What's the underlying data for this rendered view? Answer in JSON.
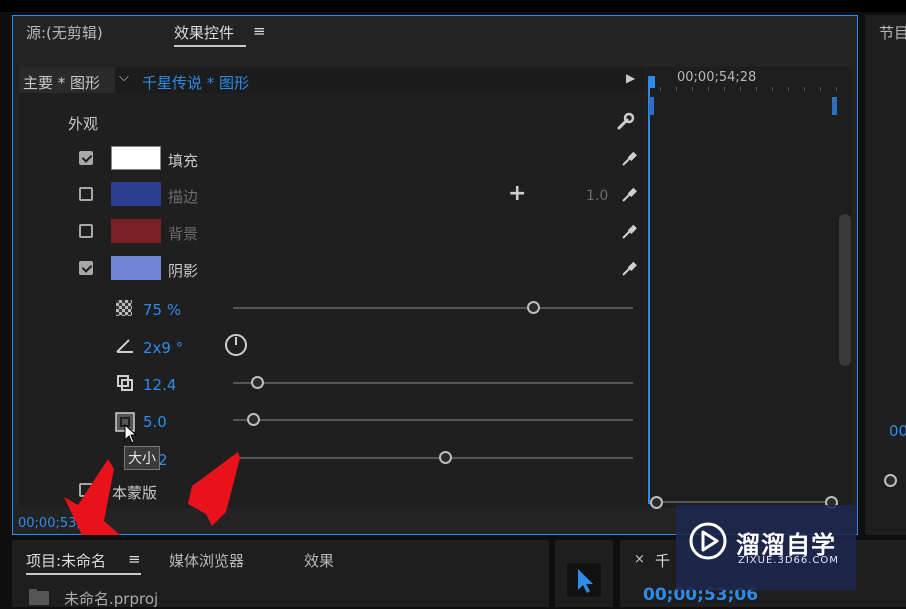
{
  "panels": {
    "source_tab": "源:(无剪辑)",
    "effect_controls_tab": "效果控件",
    "program_tab": "节目",
    "menu_icon": "≡"
  },
  "clip_header": {
    "master": "主要 * 图形",
    "clip": "千星传说 * 图形",
    "time": "00;00;54;28"
  },
  "appearance": {
    "section_label": "外观",
    "fill_label": "填充",
    "stroke_label": "描边",
    "stroke_width": "1.0",
    "background_label": "背景",
    "shadow_label": "阴影",
    "fill_checked": true,
    "stroke_checked": false,
    "background_checked": false,
    "shadow_checked": true,
    "colors": {
      "fill": "#ffffff",
      "stroke": "#2a3d8f",
      "background": "#7a2025",
      "shadow": "#6f86d4"
    }
  },
  "shadow": {
    "opacity": "75 %",
    "angle": "2x9 °",
    "distance": "12.4",
    "size": "5.0",
    "blur_partial": "2",
    "opacity_slider": 0.75,
    "distance_slider": 0.06,
    "size_slider": 0.05,
    "blur_slider": 0.53
  },
  "tooltip": "大小",
  "mask_label": "本蒙版",
  "timecode": "00;00;53;0",
  "bottom": {
    "project_tab": "项目:未命名",
    "media_browser_tab": "媒体浏览器",
    "effects_tab": "效果",
    "project_file": "未命名.prproj",
    "seq_label": "千",
    "seq_close": "×",
    "seq_time": "00;00;53;06",
    "right_partial": "00"
  },
  "watermark": {
    "brand": "溜溜自学",
    "url": "ZIXUE.3D66.COM"
  }
}
